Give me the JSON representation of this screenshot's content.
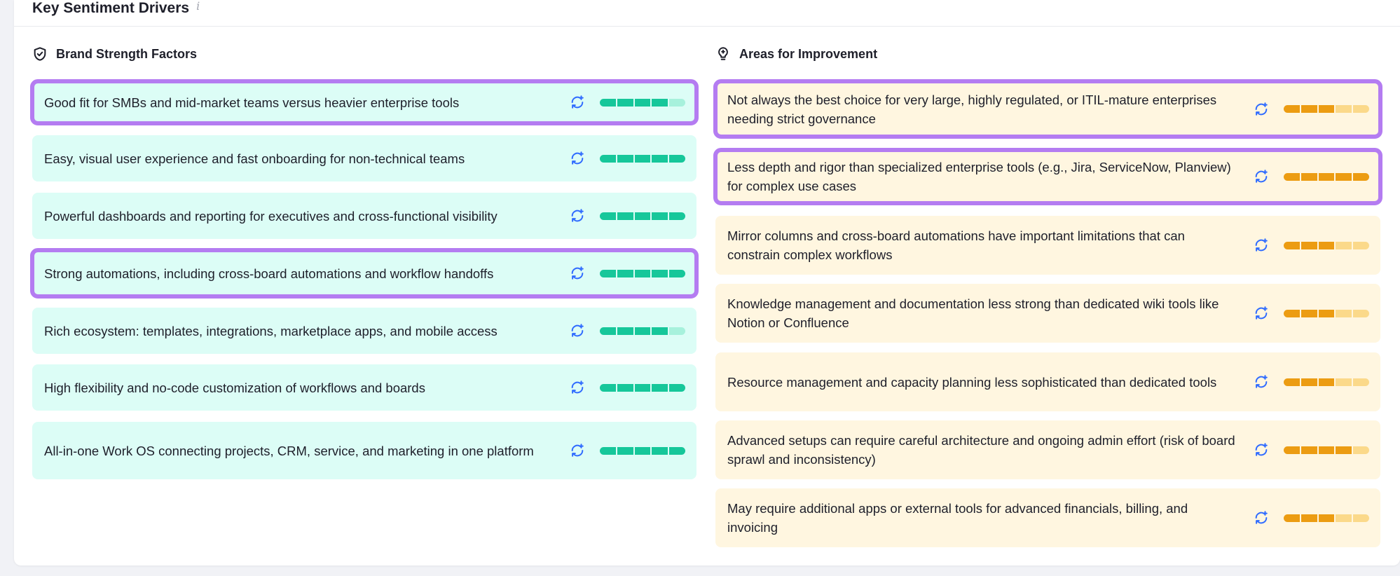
{
  "header": {
    "title": "Key Sentiment Drivers",
    "info_glyph": "i"
  },
  "strengths": {
    "title": "Brand Strength Factors",
    "icon": "shield-check-icon",
    "colors": {
      "bg": "#dcfdf6",
      "fill": "#16c79a",
      "empty": "#a7f1dc"
    },
    "items": [
      {
        "text": "Good fit for SMBs and mid-market teams versus heavier enterprise tools",
        "score": 0.8,
        "highlighted": true
      },
      {
        "text": "Easy, visual user experience and fast onboarding for non-technical teams",
        "score": 1.0,
        "highlighted": false
      },
      {
        "text": "Powerful dashboards and reporting for executives and cross-functional visibility",
        "score": 1.0,
        "highlighted": false
      },
      {
        "text": "Strong automations, including cross-board automations and workflow handoffs",
        "score": 1.0,
        "highlighted": true
      },
      {
        "text": "Rich ecosystem: templates, integrations, marketplace apps, and mobile access",
        "score": 0.8,
        "highlighted": false
      },
      {
        "text": "High flexibility and no-code customization of workflows and boards",
        "score": 1.0,
        "highlighted": false
      },
      {
        "text": "All-in-one Work OS connecting projects, CRM, service, and marketing in one platform",
        "score": 1.0,
        "highlighted": false
      }
    ]
  },
  "improvements": {
    "title": "Areas for Improvement",
    "icon": "lightbulb-icon",
    "colors": {
      "bg": "#fff6e0",
      "fill": "#ec9c12",
      "empty": "#fbd98a"
    },
    "items": [
      {
        "text": "Not always the best choice for very large, highly regulated, or ITIL-mature enterprises needing strict governance",
        "score": 0.6,
        "highlighted": true
      },
      {
        "text": "Less depth and rigor than specialized enterprise tools (e.g., Jira, ServiceNow, Planview) for complex use cases",
        "score": 1.0,
        "highlighted": true
      },
      {
        "text": "Mirror columns and cross-board automations have important limitations that can constrain complex workflows",
        "score": 0.6,
        "highlighted": false
      },
      {
        "text": "Knowledge management and documentation less strong than dedicated wiki tools like Notion or Confluence",
        "score": 0.6,
        "highlighted": false
      },
      {
        "text": "Resource management and capacity planning less sophisticated than dedicated tools",
        "score": 0.6,
        "highlighted": false
      },
      {
        "text": "Advanced setups can require careful architecture and ongoing admin effort (risk of board sprawl and inconsistency)",
        "score": 0.8,
        "highlighted": false
      },
      {
        "text": "May require additional apps or external tools for advanced financials, billing, and invoicing",
        "score": 0.6,
        "highlighted": false
      }
    ]
  }
}
